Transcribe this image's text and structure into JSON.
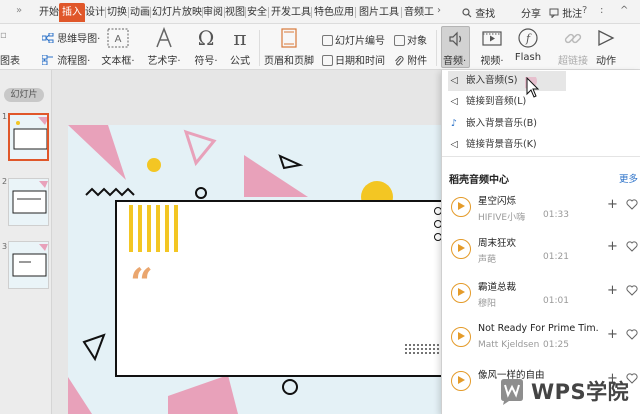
{
  "tabs": {
    "more": "»",
    "items": [
      "开始",
      "插入",
      "设计",
      "切换",
      "动画",
      "幻灯片放映",
      "审阅",
      "视图",
      "安全",
      "开发工具",
      "特色应用",
      "图片工具",
      "音频工"
    ],
    "active": "插入",
    "overflow": "›",
    "search": "查找",
    "share": "分享",
    "comment": "批注"
  },
  "ribbon": {
    "mindmap": "思维导图·",
    "flowchart": "流程图·",
    "chart_partial": "图表",
    "textbox": "文本框·",
    "wordart": "艺术字·",
    "symbol": "符号·",
    "formula": "公式",
    "header_footer": "页眉和页脚",
    "slide_number": "幻灯片编号",
    "object": "对象",
    "datetime": "日期和时间",
    "attachment": "附件",
    "audio": "音频·",
    "video": "视频·",
    "flash": "Flash",
    "hyperlink": "超链接",
    "action": "动作"
  },
  "left_pane": {
    "tab_label": "幻灯片",
    "thumb_numbers": [
      "1",
      "2",
      "3"
    ]
  },
  "dropdown": {
    "menu": [
      {
        "icon": "speaker-icon",
        "label": "嵌入音频(S)"
      },
      {
        "icon": "link-audio-icon",
        "label": "链接到音频(L)"
      },
      {
        "icon": "music-note-icon",
        "label": "嵌入背景音乐(B)"
      },
      {
        "icon": "link-bg-music-icon",
        "label": "链接背景音乐(K)"
      }
    ],
    "section_title": "稻壳音频中心",
    "more": "更多",
    "tracks": [
      {
        "name": "星空闪烁",
        "artist": "HIFIVE小嗨",
        "duration": "01:33"
      },
      {
        "name": "周末狂欢",
        "artist": "声葩",
        "duration": "01:21"
      },
      {
        "name": "霸道总裁",
        "artist": "穆阳",
        "duration": "01:01"
      },
      {
        "name": "Not Ready For Prime Tim.",
        "artist": "Matt Kjeldsen",
        "duration": "01:25"
      },
      {
        "name": "像风一样的自由",
        "artist": "",
        "duration": ""
      }
    ]
  },
  "watermark": "WPS学院",
  "colors": {
    "accent": "#e0572a",
    "pink": "#e8a1ba",
    "yellow": "#f3c623",
    "cyan": "#2aa4d6",
    "orange_play": "#e49b2a"
  }
}
